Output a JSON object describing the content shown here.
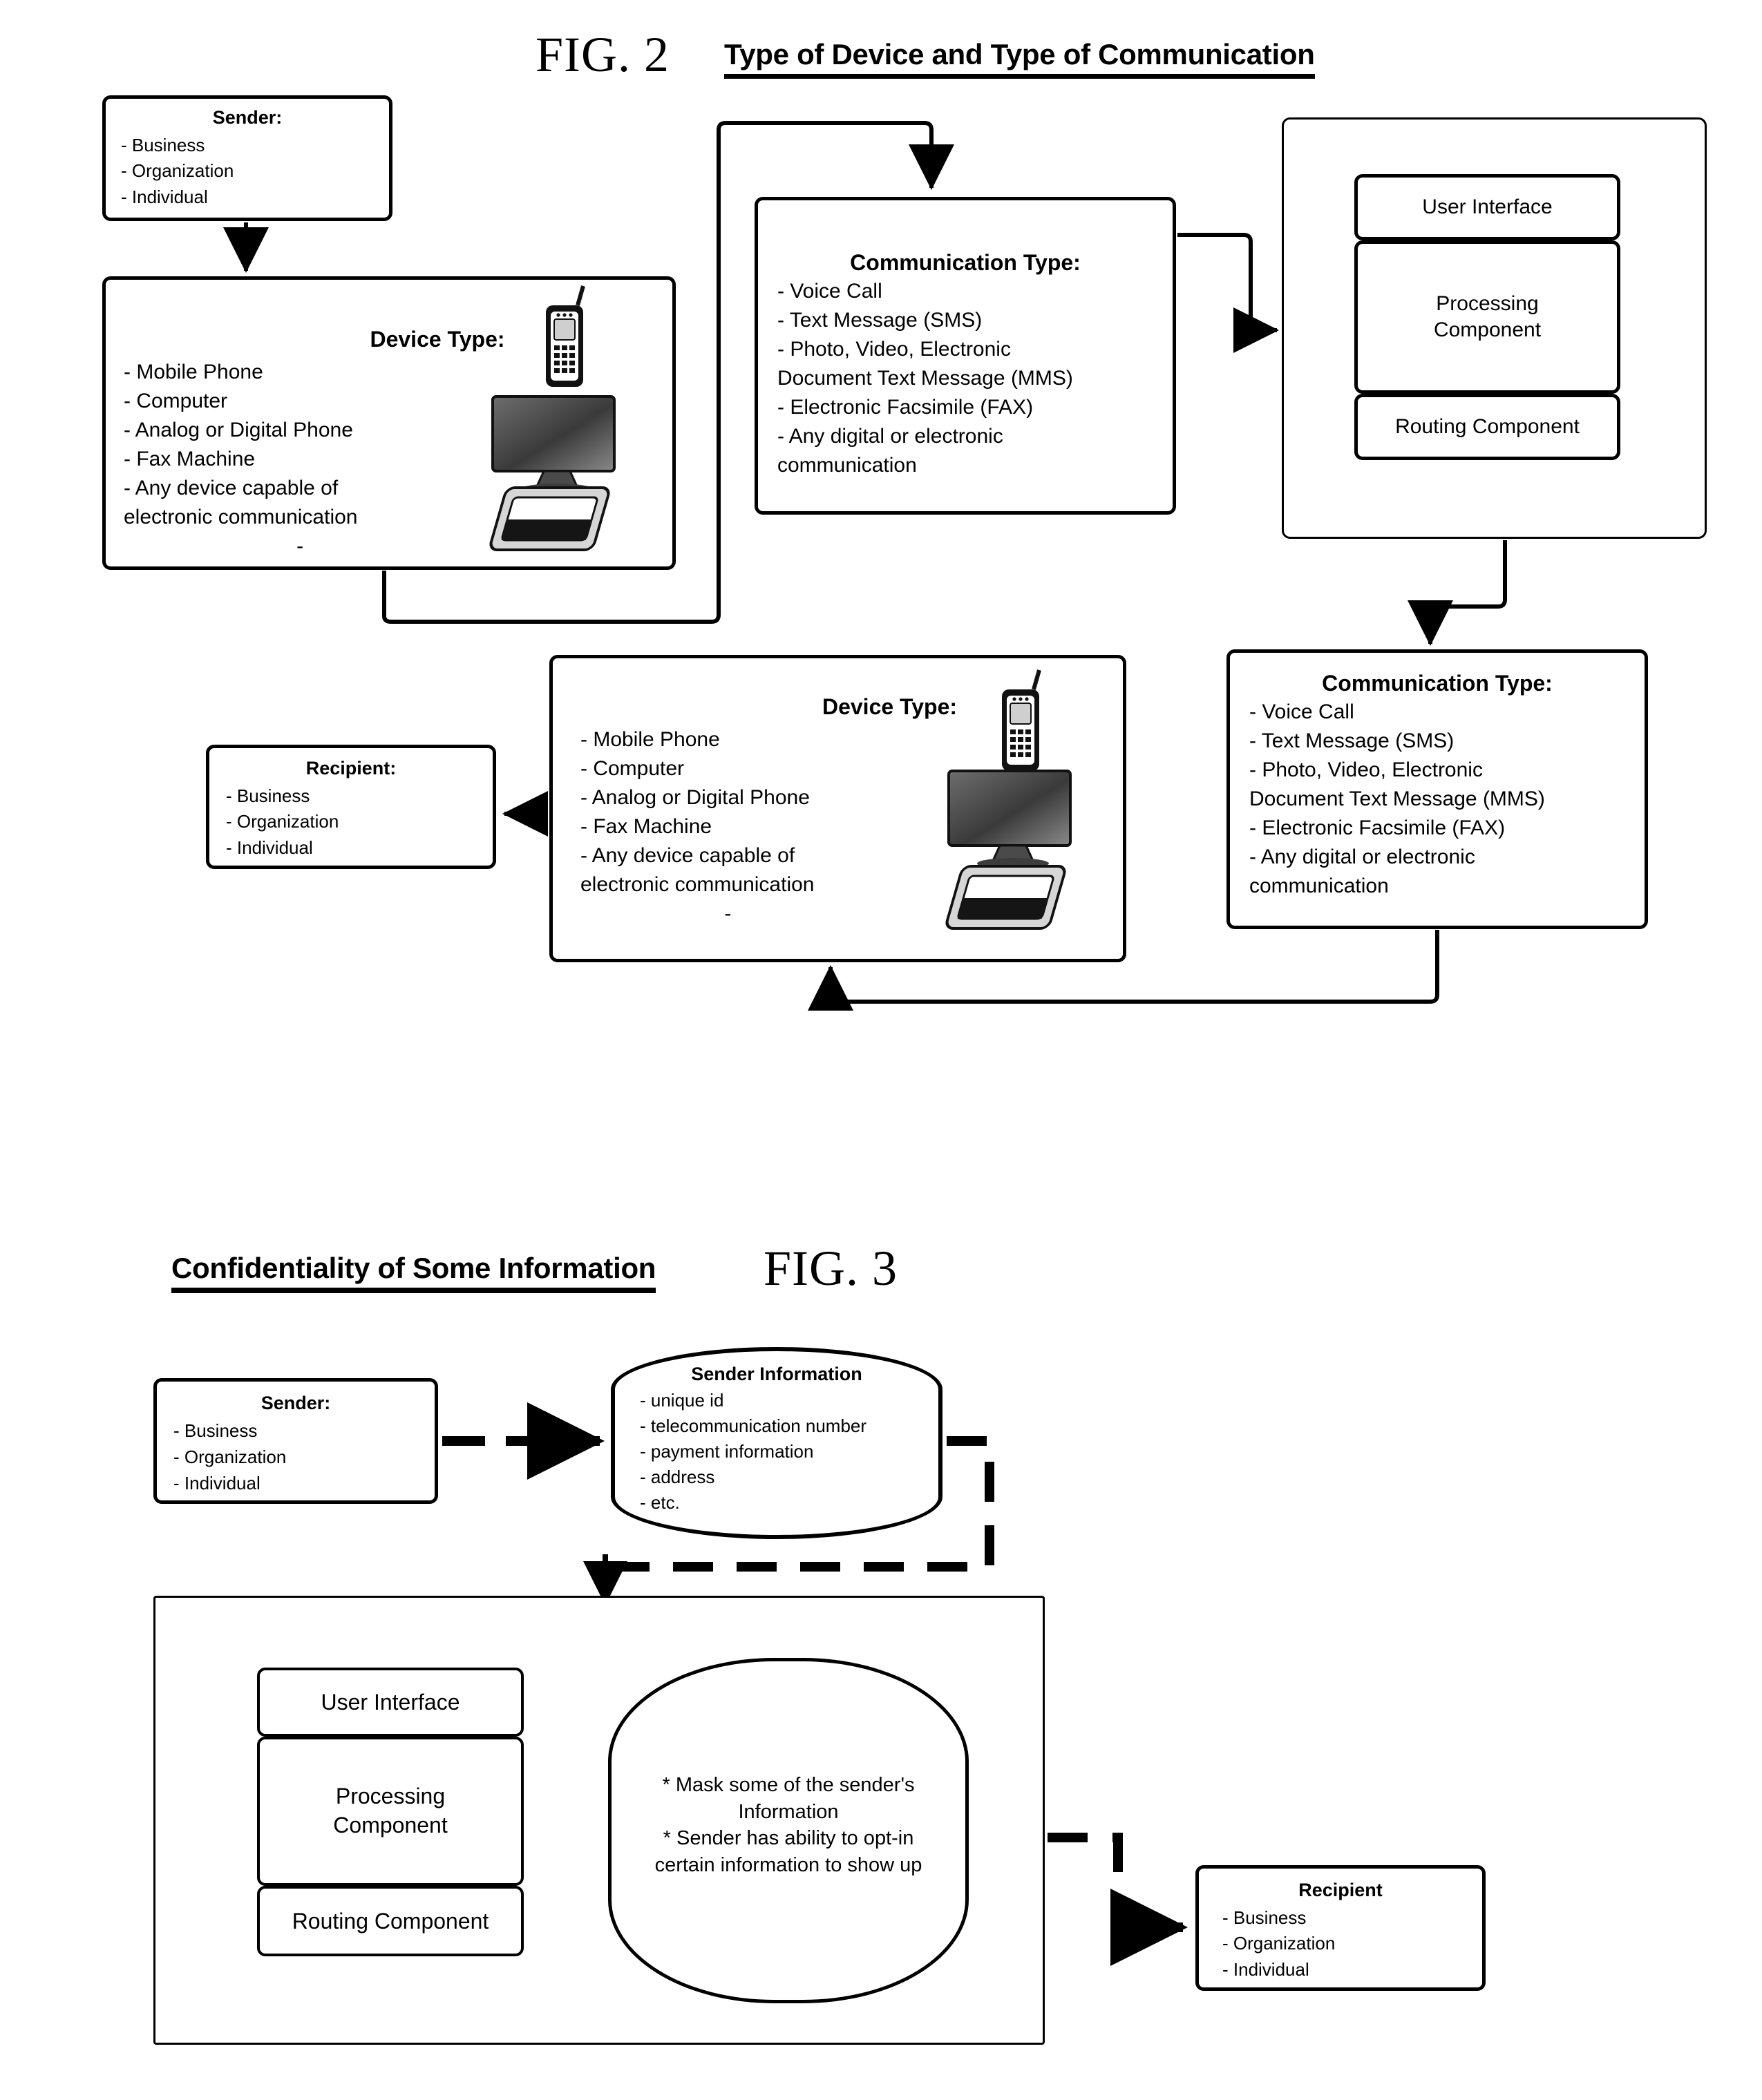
{
  "figures": {
    "fig2": {
      "number": "FIG. 2",
      "title": "Type of Device and Type of Communication",
      "sender": {
        "header": "Sender:",
        "items": [
          "- Business",
          "- Organization",
          "- Individual"
        ]
      },
      "device_type_1": {
        "header": "Device Type:",
        "items": [
          "- Mobile Phone",
          "- Computer",
          "- Analog or Digital Phone",
          "- Fax Machine",
          "- Any device capable of",
          "electronic communication",
          "                              -"
        ],
        "icons": [
          "mobile-phone-icon",
          "desktop-monitor-icon",
          "tablet-icon"
        ]
      },
      "communication_type_1": {
        "header": "Communication Type:",
        "items": [
          "- Voice Call",
          "- Text Message (SMS)",
          "- Photo, Video, Electronic",
          "Document Text Message (MMS)",
          "- Electronic Facsimile (FAX)",
          "- Any digital or electronic",
          "communication"
        ]
      },
      "system": {
        "user_interface": "User Interface",
        "processing_component": "Processing\nComponent",
        "routing_component": "Routing Component"
      },
      "communication_type_2": {
        "header": "Communication Type:",
        "items": [
          "- Voice Call",
          "- Text Message (SMS)",
          "- Photo, Video, Electronic",
          "Document Text Message (MMS)",
          "- Electronic Facsimile (FAX)",
          "- Any digital or electronic",
          "communication"
        ]
      },
      "device_type_2": {
        "header": "Device Type:",
        "items": [
          "- Mobile Phone",
          "- Computer",
          "- Analog or Digital Phone",
          "- Fax Machine",
          "- Any device capable of",
          "electronic communication",
          "                         -"
        ],
        "icons": [
          "mobile-phone-icon",
          "desktop-monitor-icon",
          "tablet-icon"
        ]
      },
      "recipient": {
        "header": "Recipient:",
        "items": [
          "- Business",
          "- Organization",
          "- Individual"
        ]
      }
    },
    "fig3": {
      "number": "FIG. 3",
      "title": "Confidentiality of Some Information",
      "sender": {
        "header": "Sender:",
        "items": [
          "- Business",
          "- Organization",
          "- Individual"
        ]
      },
      "sender_information": {
        "header": "Sender Information",
        "items": [
          "- unique id",
          "- telecommunication number",
          "- payment information",
          "- address",
          "- etc."
        ]
      },
      "system": {
        "user_interface": "User Interface",
        "processing_component": "Processing\nComponent",
        "routing_component": "Routing Component"
      },
      "mask_note": "* Mask some of the sender's\nInformation\n* Sender has ability to opt-in\ncertain information to show up",
      "recipient": {
        "header": "Recipient",
        "items": [
          "- Business",
          "- Organization",
          "- Individual"
        ]
      }
    }
  },
  "colors": {
    "stroke": "#000000",
    "background": "#ffffff"
  }
}
